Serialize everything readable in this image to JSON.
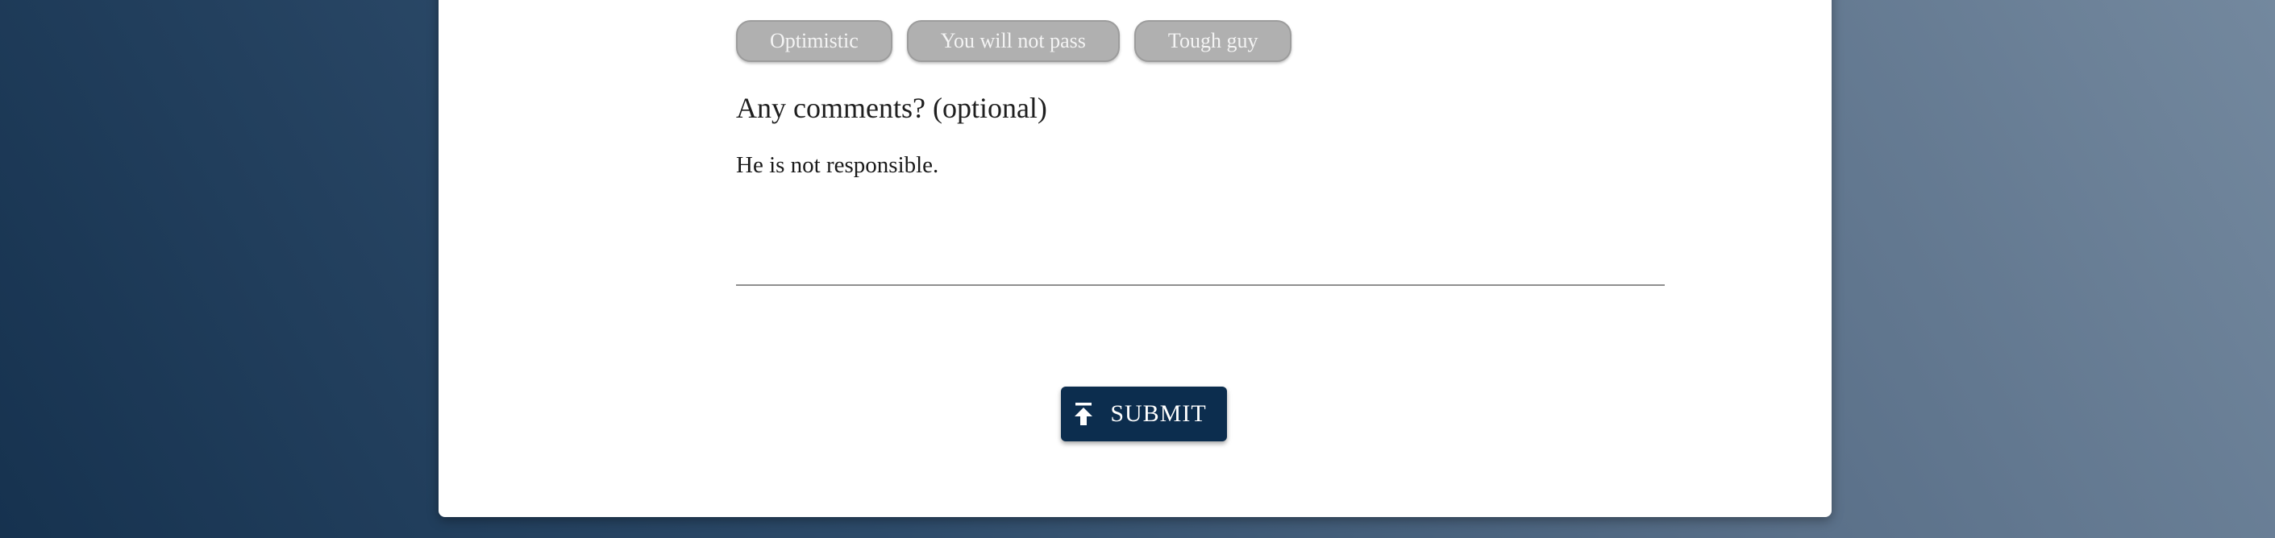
{
  "chips": [
    {
      "label": "Optimistic"
    },
    {
      "label": "You will not pass"
    },
    {
      "label": "Tough guy"
    }
  ],
  "comments": {
    "question": "Any comments? (optional)",
    "value": "He is not responsible."
  },
  "submit": {
    "label": "SUBMIT",
    "icon": "upload-icon"
  },
  "colors": {
    "button": "#0c2d4e",
    "chip": "#b0b0b0",
    "card": "#ffffff"
  }
}
